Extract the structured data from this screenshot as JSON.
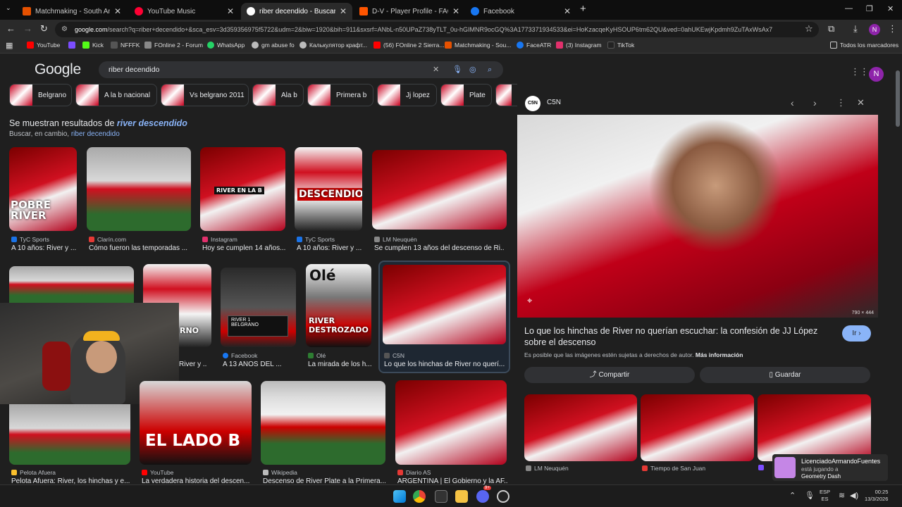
{
  "browser": {
    "tabs": [
      {
        "title": "Matchmaking - South America",
        "color": "#e65100",
        "active": false
      },
      {
        "title": "YouTube Music",
        "color": "#ff0033",
        "active": false
      },
      {
        "title": "riber decendido - Buscar con Go",
        "color": "#ffffff",
        "active": true
      },
      {
        "title": "D-V - Player Profile - FACEIT.co",
        "color": "#ff5500",
        "active": false
      },
      {
        "title": "Facebook",
        "color": "#1877f2",
        "active": false
      }
    ],
    "new_tab": "+",
    "url_host": "google.com",
    "url_rest": "/search?q=riber+decendido+&sca_esv=3d359356975f5722&udm=2&biw=1920&bih=911&sxsrf=ANbL-n50UPaZ738yTLT_0u-hGIMNR9ocGQ%3A1773371934533&ei=HoKzacqeKyHSOUP6tm62QU&ved=0ahUKEwjKpdmh9ZuTAxWsAx7",
    "profile_initial": "N"
  },
  "bookmarks": [
    {
      "label": "YouTube",
      "color": "#ff0000"
    },
    {
      "label": "",
      "color": "#7c4dff"
    },
    {
      "label": "Kick",
      "color": "#53fc18"
    },
    {
      "label": "NFFFK",
      "color": "#555555"
    },
    {
      "label": "FOnline 2 - Forum",
      "color": "#888888"
    },
    {
      "label": "WhatsApp",
      "color": "#25d366"
    },
    {
      "label": "gm abuse fo",
      "color": "#bbbbbb"
    },
    {
      "label": "Калькулятор крафт...",
      "color": "#bbbbbb"
    },
    {
      "label": "(56) FOnline 2 Sierra...",
      "color": "#ff0000"
    },
    {
      "label": "Matchmaking - Sou...",
      "color": "#e65100"
    },
    {
      "label": "FaceATR",
      "color": "#1877f2"
    },
    {
      "label": "(3) Instagram",
      "color": "#e1306c"
    },
    {
      "label": "TikTok",
      "color": "#222222"
    }
  ],
  "all_bookmarks": "Todos los marcadores",
  "google": {
    "logo": "Google",
    "query": "riber decendido",
    "chips": [
      "Belgrano",
      "A la b nacional",
      "Vs belgrano 2011",
      "Ala b",
      "Primera b",
      "Jj lopez",
      "Plate",
      ""
    ],
    "showing_prefix": "Se muestran resultados de ",
    "showing_term": "river descendido",
    "instead_prefix": "Buscar, en cambio, ",
    "instead_term": "riber decendido"
  },
  "results": [
    {
      "source": "TyC Sports",
      "caption": "A 10 años: River y ...",
      "overlay": "POBRE RIVER",
      "color": "#1a73e8"
    },
    {
      "source": "Clarín.com",
      "caption": "Cómo fueron las temporadas ...",
      "overlay": "",
      "color": "#e53935"
    },
    {
      "source": "Instagram",
      "caption": "Hoy se cumplen 14 años...",
      "overlay": "RIVER EN LA B",
      "color": "#e1306c"
    },
    {
      "source": "TyC Sports",
      "caption": "A 10 años: River y ...",
      "overlay": "DESCENDIO",
      "color": "#1a73e8"
    },
    {
      "source": "LM Neuquén",
      "caption": "Se cumplen 13 años del descenso de Ri...",
      "overlay": "",
      "color": "#888888"
    },
    {
      "source": "Facebook",
      "caption": "A 13 AÑOS DEL ...",
      "overlay": "",
      "color": "#1877f2"
    },
    {
      "source": "Olé",
      "caption": "La mirada de los h...",
      "overlay": "RIVER DESTROZADO",
      "color": "#2e7d32"
    },
    {
      "source": "C5N",
      "caption": "Lo que los hinchas de River no querí...",
      "overlay": "",
      "color": "#555555"
    },
    {
      "source": "Pelota Afuera",
      "caption": "Pelota Afuera: River, los hinchas y e...",
      "overlay": "",
      "color": "#fbc02d"
    },
    {
      "source": "YouTube",
      "caption": "La verdadera historia del descen...",
      "overlay": "EL LADO B",
      "color": "#ff0000"
    },
    {
      "source": "Wikipedia",
      "caption": "Descenso de River Plate a la Primera...",
      "overlay": "",
      "color": "#bbbbbb"
    },
    {
      "source": "Diario AS",
      "caption": "ARGENTINA | El Gobierno y la AF...",
      "overlay": "",
      "color": "#e53935"
    }
  ],
  "partial_captions": [
    "River y ...",
    "RNO"
  ],
  "scoreboard": {
    "top": "RIVER 1",
    "bottom": "BELGRANO"
  },
  "panel": {
    "source": "C5N",
    "dims": "790 × 444",
    "title": "Lo que los hinchas de River no querían escuchar: la confesión de JJ López sobre el descenso",
    "visit": "Ir",
    "rights": "Es posible que las imágenes estén sujetas a derechos de autor.",
    "more_info": "Más información",
    "share": "Compartir",
    "save": "Guardar",
    "related": [
      {
        "source": "LM Neuquén",
        "color": "#888888"
      },
      {
        "source": "Tiempo de San Juan",
        "color": "#e53935"
      },
      {
        "source": "",
        "color": "#7c4dff"
      }
    ]
  },
  "notification": {
    "user": "LicenciadoArmandoFuentes",
    "status": "está jugando a",
    "game": "Geometry Dash"
  },
  "taskbar": {
    "lang_top": "ESP",
    "lang_bottom": "ES",
    "time": "00:25",
    "date": "13/3/2026",
    "discord_badge": "9+"
  }
}
